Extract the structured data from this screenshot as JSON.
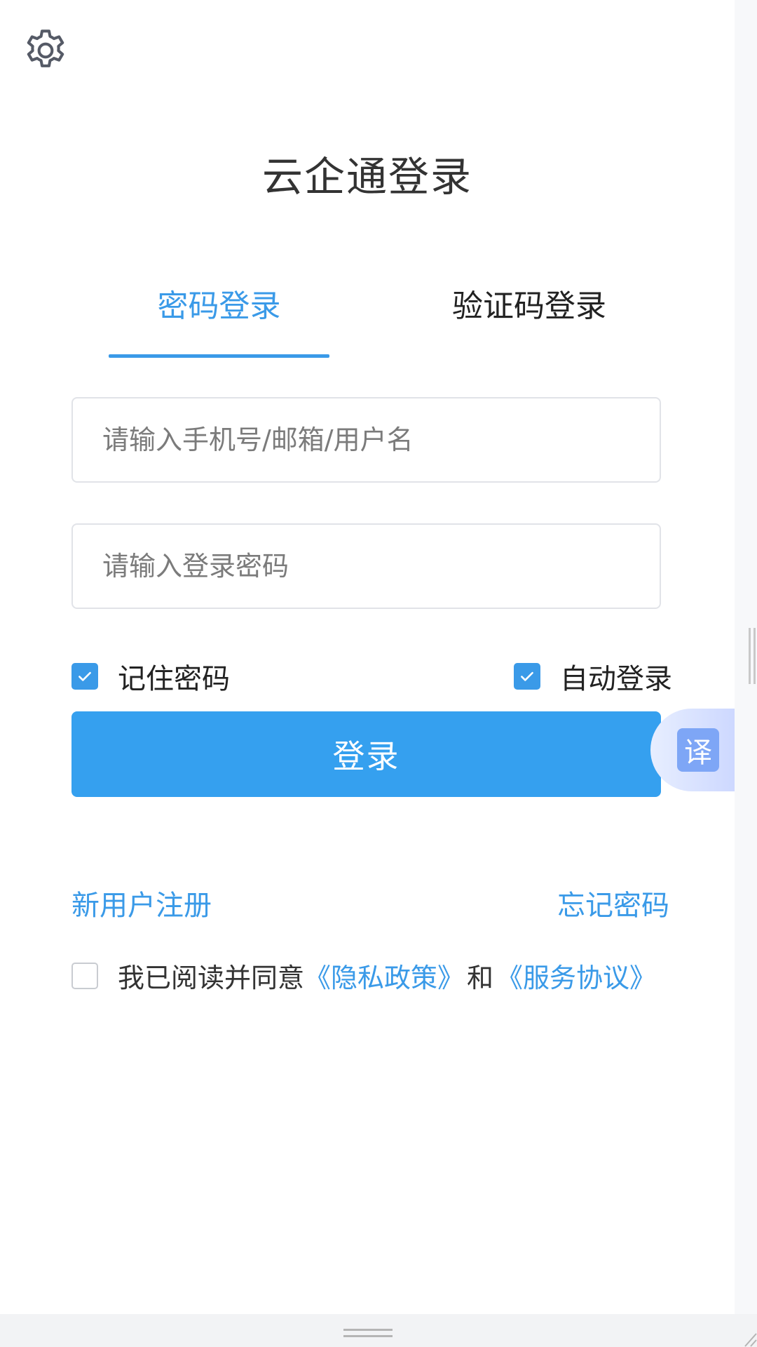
{
  "header": {
    "settings_icon": "gear-icon"
  },
  "title": "云企通登录",
  "tabs": [
    {
      "label": "密码登录",
      "active": true
    },
    {
      "label": "验证码登录",
      "active": false
    }
  ],
  "form": {
    "account_placeholder": "请输入手机号/邮箱/用户名",
    "account_value": "",
    "password_placeholder": "请输入登录密码",
    "password_value": ""
  },
  "options": {
    "remember_label": "记住密码",
    "remember_checked": true,
    "auto_login_label": "自动登录",
    "auto_login_checked": true
  },
  "login_button": "登录",
  "translate_button": "译",
  "links": {
    "register": "新用户注册",
    "forgot": "忘记密码"
  },
  "agreement": {
    "checked": false,
    "prefix": "我已阅读并同意",
    "privacy": "《隐私政策》",
    "and": "和",
    "service": "《服务协议》"
  },
  "colors": {
    "accent": "#3a9ae8",
    "button": "#35a0ef",
    "text": "#333333"
  }
}
